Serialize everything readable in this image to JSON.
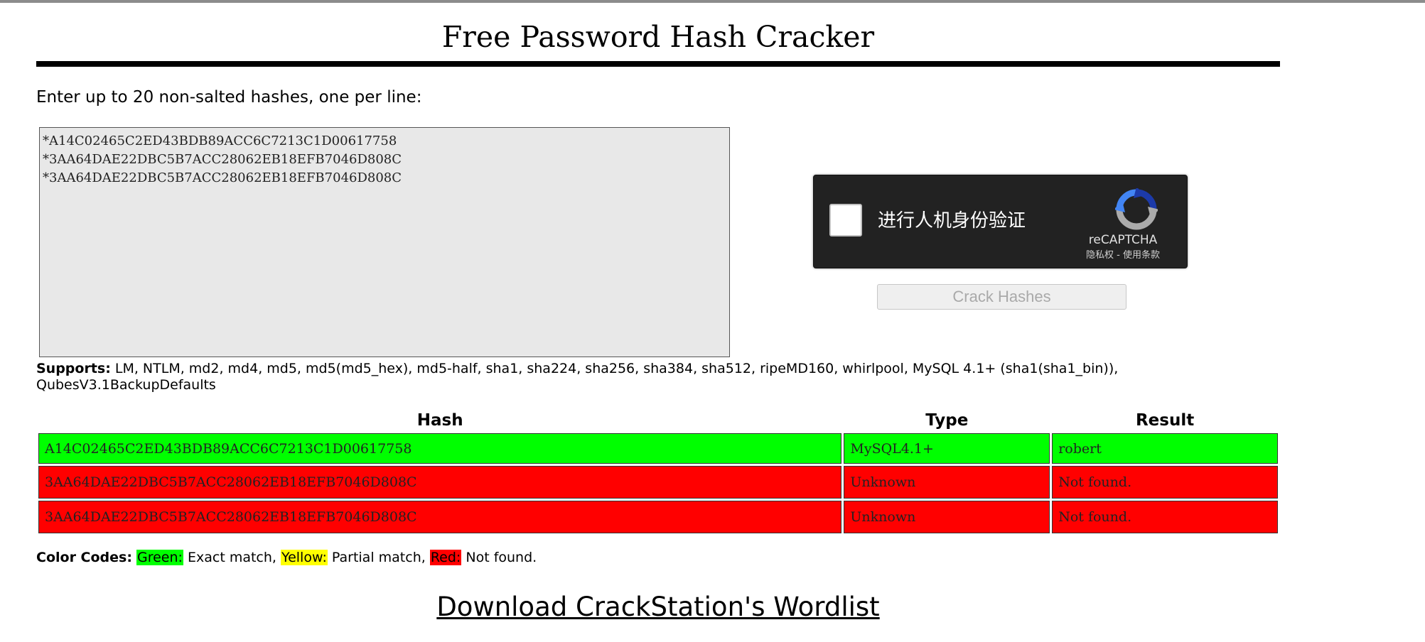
{
  "page": {
    "title": "Free Password Hash Cracker",
    "instructions": "Enter up to 20 non-salted hashes, one per line:"
  },
  "hash_input": {
    "value": "*A14C02465C2ED43BDB89ACC6C7213C1D00617758\n*3AA64DAE22DBC5B7ACC28062EB18EFB7046D808C\n*3AA64DAE22DBC5B7ACC28062EB18EFB7046D808C"
  },
  "recaptcha": {
    "label": "进行人机身份验证",
    "brand": "reCAPTCHA",
    "links": "隐私权 - 使用条款",
    "icon": "recaptcha-logo-icon"
  },
  "crack_button": {
    "label": "Crack Hashes"
  },
  "supports": {
    "label": "Supports:",
    "text": " LM, NTLM, md2, md4, md5, md5(md5_hex), md5-half, sha1, sha224, sha256, sha384, sha512, ripeMD160, whirlpool, MySQL 4.1+ (sha1(sha1_bin)), QubesV3.1BackupDefaults"
  },
  "results": {
    "headers": {
      "hash": "Hash",
      "type": "Type",
      "result": "Result"
    },
    "rows": [
      {
        "hash": "A14C02465C2ED43BDB89ACC6C7213C1D00617758",
        "type": "MySQL4.1+",
        "result": "robert",
        "color": "#00ff00"
      },
      {
        "hash": "3AA64DAE22DBC5B7ACC28062EB18EFB7046D808C",
        "type": "Unknown",
        "result": "Not found.",
        "color": "#ff0000"
      },
      {
        "hash": "3AA64DAE22DBC5B7ACC28062EB18EFB7046D808C",
        "type": "Unknown",
        "result": "Not found.",
        "color": "#ff0000"
      }
    ]
  },
  "legend": {
    "label": "Color Codes:",
    "green_label": "Green:",
    "green_text": " Exact match, ",
    "green_color": "#00ff00",
    "yellow_label": "Yellow:",
    "yellow_text": " Partial match, ",
    "yellow_color": "#ffff00",
    "red_label": "Red:",
    "red_text": " Not found.",
    "red_color": "#ff0000"
  },
  "download": {
    "label": "Download CrackStation's Wordlist"
  }
}
